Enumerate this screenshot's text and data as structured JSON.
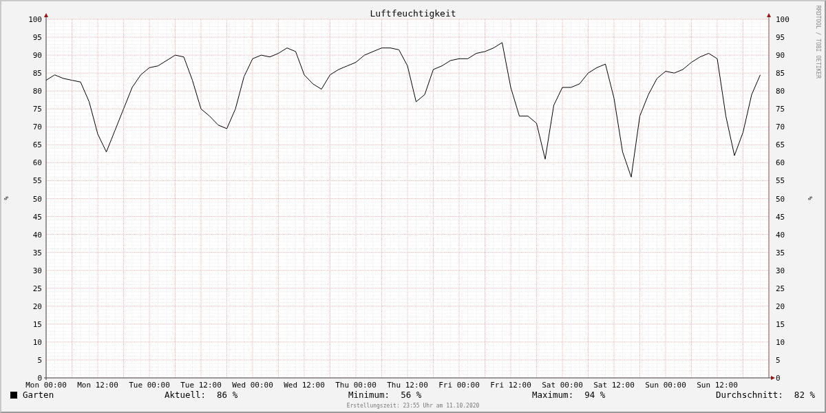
{
  "graph": {
    "title": "Luftfeuchtigkeit",
    "side_note": "RRDTOOL / TOBI OETIKER",
    "right_axis": {
      "label": "%",
      "ticks": [
        "100",
        "95",
        "90",
        "85",
        "80",
        "75",
        "70",
        "65",
        "60",
        "55",
        "50",
        "45",
        "40",
        "35",
        "30",
        "25",
        "20",
        "15",
        "10",
        "5",
        "0"
      ]
    },
    "chart_data": {
      "type": "line",
      "ylabel": "%",
      "grid": true,
      "categories": [
        "Mon 00:00",
        null,
        null,
        null,
        null,
        null,
        "Mon 12:00",
        null,
        null,
        null,
        null,
        null,
        "Tue 00:00",
        null,
        null,
        null,
        null,
        null,
        "Tue 12:00",
        null,
        null,
        null,
        null,
        null,
        "Wed 00:00",
        null,
        null,
        null,
        null,
        null,
        "Wed 12:00",
        null,
        null,
        null,
        null,
        null,
        "Thu 00:00",
        null,
        null,
        null,
        null,
        null,
        "Thu 12:00",
        null,
        null,
        null,
        null,
        null,
        "Fri 00:00",
        null,
        null,
        null,
        null,
        null,
        "Fri 12:00",
        null,
        null,
        null,
        null,
        null,
        "Sat 00:00",
        null,
        null,
        null,
        null,
        null,
        "Sat 12:00",
        null,
        null,
        null,
        null,
        null,
        "Sun 00:00",
        null,
        null,
        null,
        null,
        null,
        "Sun 12:00",
        null,
        null,
        null,
        null,
        null
      ],
      "ylim": [
        0,
        100
      ],
      "yticks": [
        0,
        5,
        10,
        15,
        20,
        25,
        30,
        35,
        40,
        45,
        50,
        55,
        60,
        65,
        70,
        75,
        80,
        85,
        90,
        95,
        100
      ],
      "series": [
        {
          "name": "Garten",
          "color": "#000000",
          "values": [
            83,
            84.5,
            83.5,
            83,
            82.5,
            77,
            68,
            63,
            69,
            75,
            81,
            84.5,
            86.5,
            87,
            88.5,
            90,
            89.5,
            83,
            75,
            73,
            70.5,
            69.5,
            75,
            84,
            89,
            90,
            89.5,
            90.5,
            92,
            91,
            84.5,
            82,
            80.5,
            84.5,
            86,
            87,
            88,
            90,
            91,
            92,
            92,
            91.5,
            87,
            77,
            79,
            86,
            87,
            88.5,
            89,
            89,
            90.5,
            91,
            92,
            93.5,
            81,
            73,
            73,
            71,
            61,
            76,
            81,
            81,
            82,
            85,
            86.5,
            87.5,
            78,
            63,
            56,
            73,
            79,
            83.5,
            85.5,
            85,
            86,
            88,
            89.5,
            90.5,
            89,
            73,
            62,
            68.5,
            79,
            84.5
          ]
        }
      ]
    },
    "stats": [
      {
        "label": "Aktuell:",
        "value": "86 %"
      },
      {
        "label": "Minimum:",
        "value": "56 %"
      },
      {
        "label": "Maximum:",
        "value": "94 %"
      },
      {
        "label": "Durchschnitt:",
        "value": "82 %"
      }
    ],
    "footer": "Erstellungszeit: 23:55 Uhr am 11.10.2020"
  }
}
